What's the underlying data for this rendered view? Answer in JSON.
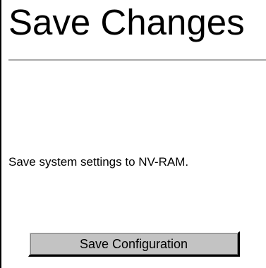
{
  "page": {
    "title": "Save Changes",
    "description": "Save system settings to NV-RAM."
  },
  "actions": {
    "save_label": "Save Configuration"
  },
  "colors": {
    "background": "#ffffff",
    "rule": "#a9a9a9",
    "button_face": "#c3c3c3"
  }
}
